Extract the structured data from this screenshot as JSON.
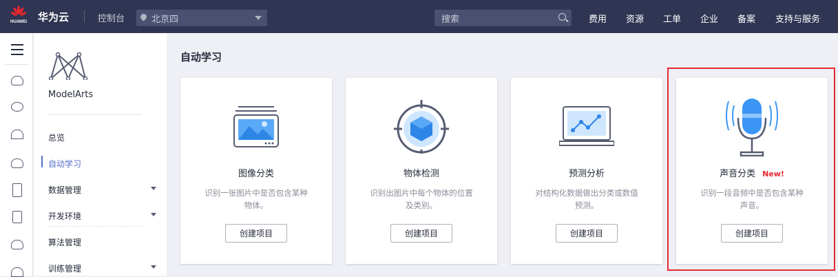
{
  "header": {
    "logo_text": "HUAWEI",
    "brand": "华为云",
    "console": "控制台",
    "region": "北京四",
    "search_placeholder": "搜索",
    "nav": [
      "费用",
      "资源",
      "工单",
      "企业",
      "备案",
      "支持与服务"
    ]
  },
  "sidebar": {
    "service_name": "ModelArts",
    "items": [
      {
        "label": "总览"
      },
      {
        "label": "自动学习",
        "active": true
      },
      {
        "label": "数据管理",
        "expandable": true
      },
      {
        "label": "开发环境",
        "expandable": true
      },
      {
        "label": "算法管理"
      },
      {
        "label": "训练管理",
        "expandable": true
      }
    ]
  },
  "main": {
    "title": "自动学习",
    "cards": [
      {
        "name": "图像分类",
        "desc": "识别一张图片中是否包含某种物体。",
        "button": "创建项目"
      },
      {
        "name": "物体检测",
        "desc": "识别出图片中每个物体的位置及类别。",
        "button": "创建项目"
      },
      {
        "name": "预测分析",
        "desc": "对结构化数据做出分类或数值预测。",
        "button": "创建项目"
      },
      {
        "name": "声音分类",
        "badge": "New!",
        "desc": "识别一段音频中是否包含某种声音。",
        "button": "创建项目"
      }
    ]
  },
  "colors": {
    "header_bg": "#2f3552",
    "accent": "#526ecc",
    "highlight": "#e5282e"
  }
}
